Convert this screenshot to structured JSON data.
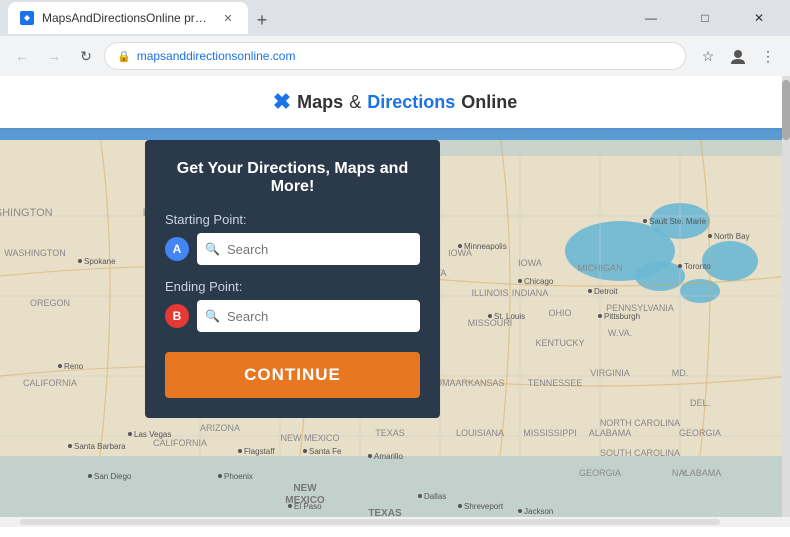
{
  "browser": {
    "tab_title": "MapsAndDirectionsOnline provi...",
    "new_tab_label": "+",
    "address": "mapsanddirectionsonline.com",
    "nav": {
      "back_label": "←",
      "forward_label": "→",
      "reload_label": "↻"
    },
    "controls": {
      "minimize": "—",
      "maximize": "□",
      "close": "✕"
    }
  },
  "header": {
    "logo_maps": "Maps",
    "logo_amp": " & ",
    "logo_directions": "Directions",
    "logo_online": " Online"
  },
  "card": {
    "title": "Get Your Directions, Maps and More!",
    "starting_label": "Starting Point:",
    "ending_label": "Ending Point:",
    "starting_placeholder": "Search",
    "ending_placeholder": "Search",
    "badge_a": "A",
    "badge_b": "B",
    "continue_label": "CONTINUE"
  }
}
